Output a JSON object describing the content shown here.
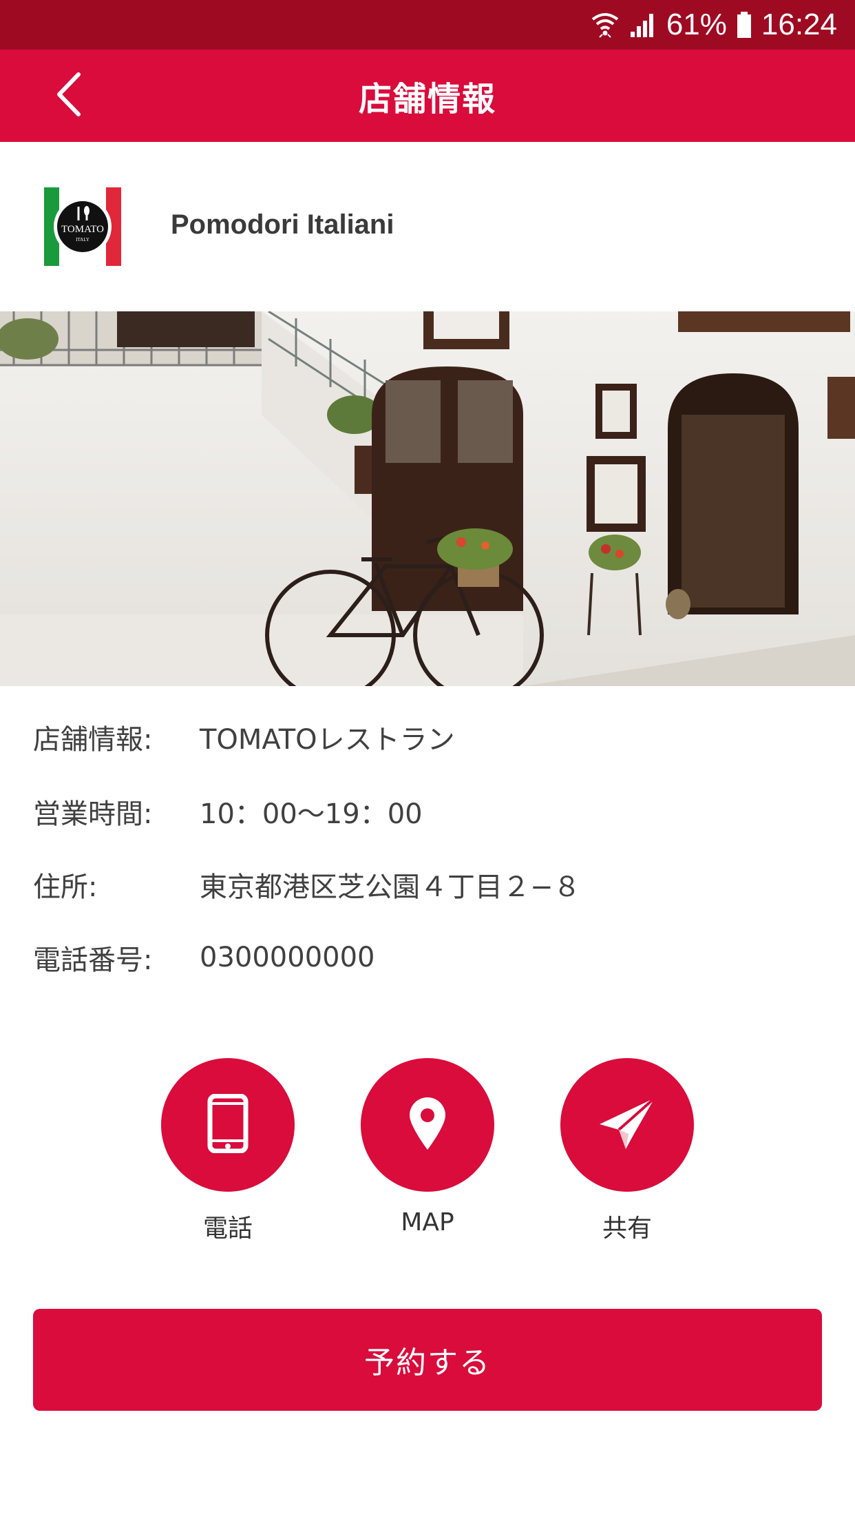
{
  "status_bar": {
    "battery": "61%",
    "time": "16:24"
  },
  "app_bar": {
    "title": "店舗情報"
  },
  "shop": {
    "logo_text": "TOMATO",
    "logo_subtext": "ITALY",
    "name": "Pomodori Italiani"
  },
  "info": {
    "rows": [
      {
        "label": "店舗情報:",
        "value": "TOMATOレストラン"
      },
      {
        "label": "営業時間:",
        "value": "10：00〜19：00"
      },
      {
        "label": "住所:",
        "value": "東京都港区芝公園４丁目２−８"
      },
      {
        "label": "電話番号:",
        "value": "0300000000"
      }
    ]
  },
  "actions": [
    {
      "label": "電話",
      "icon": "phone-icon"
    },
    {
      "label": "MAP",
      "icon": "map-pin-icon"
    },
    {
      "label": "共有",
      "icon": "share-icon"
    }
  ],
  "reserve": {
    "label": "予約する"
  },
  "colors": {
    "primary": "#d90c3c",
    "status_bar": "#9e0a22",
    "text": "#333333"
  }
}
